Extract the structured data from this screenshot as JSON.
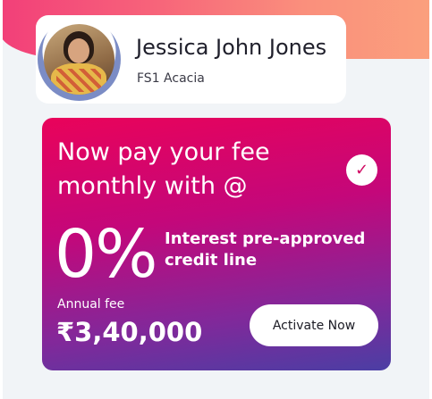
{
  "profile": {
    "name": "Jessica John Jones",
    "subtitle": "FS1 Acacia",
    "avatar_icon": "student-avatar-photo"
  },
  "fee_card": {
    "headline": "Now pay your fee monthly with @",
    "rate": "0%",
    "rate_description": "Interest pre-approved credit line",
    "fee_label": "Annual fee",
    "fee_amount": "₹3,40,000",
    "cta_label": "Activate Now",
    "badge_icon": "checkmark-icon",
    "badge_glyph": "✓"
  },
  "colors": {
    "banner_start": "#f23f79",
    "banner_end": "#fba07d",
    "card_top": "#e9035a",
    "card_bottom": "#4b3ea4",
    "badge_check": "#d10a63"
  }
}
